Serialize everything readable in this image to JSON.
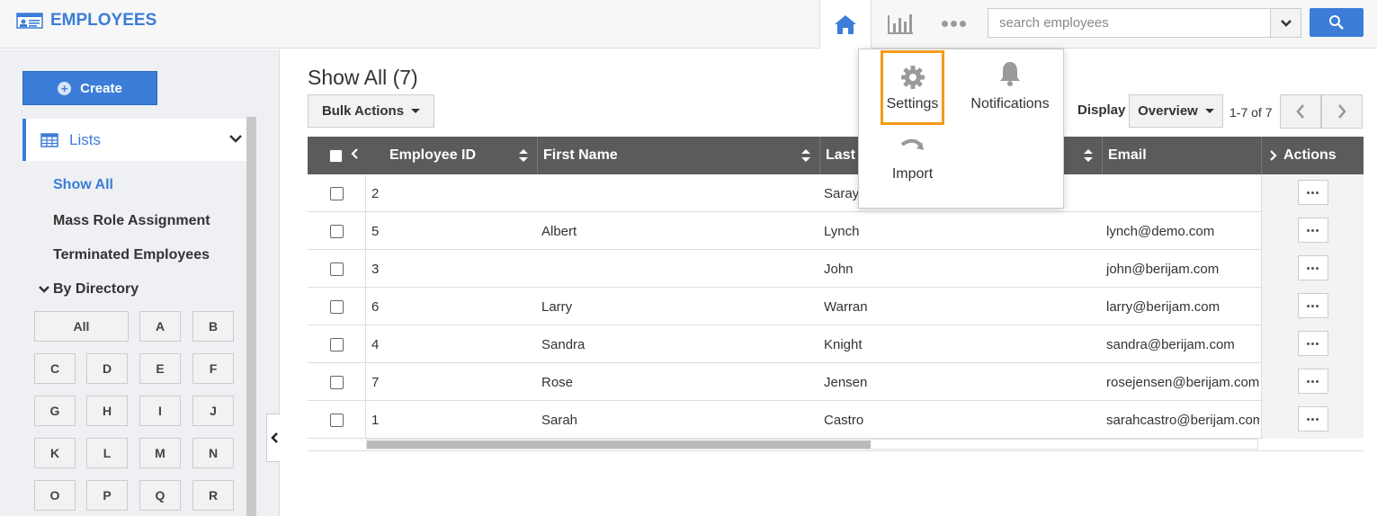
{
  "app": {
    "title": "EMPLOYEES"
  },
  "header": {
    "search": {
      "placeholder": "search employees",
      "value": ""
    }
  },
  "sidebar": {
    "create_label": "Create",
    "lists_label": "Lists",
    "links": [
      "Show All",
      "Mass Role Assignment",
      "Terminated Employees"
    ],
    "directory_label": "By Directory",
    "letters": [
      "All",
      "A",
      "B",
      "C",
      "D",
      "E",
      "F",
      "G",
      "H",
      "I",
      "J",
      "K",
      "L",
      "M",
      "N",
      "O",
      "P",
      "Q",
      "R"
    ]
  },
  "main": {
    "title": "Show All (7)",
    "bulk_actions": "Bulk Actions",
    "display_label": "Display",
    "display_value": "Overview",
    "pager": "1-7 of 7"
  },
  "table": {
    "columns": [
      "Employee ID",
      "First Name",
      "Last",
      "Email",
      "Actions"
    ],
    "rows": [
      {
        "id": "2",
        "first": "",
        "last": "Saray",
        "email": ""
      },
      {
        "id": "5",
        "first": "Albert",
        "last": "Lynch",
        "email": "lynch@demo.com"
      },
      {
        "id": "3",
        "first": "",
        "last": "John",
        "email": "john@berijam.com"
      },
      {
        "id": "6",
        "first": "Larry",
        "last": "Warran",
        "email": "larry@berijam.com"
      },
      {
        "id": "4",
        "first": "Sandra",
        "last": "Knight",
        "email": "sandra@berijam.com"
      },
      {
        "id": "7",
        "first": "Rose",
        "last": "Jensen",
        "email": "rosejensen@berijam.com"
      },
      {
        "id": "1",
        "first": "Sarah",
        "last": "Castro",
        "email": "sarahcastro@berijam.com"
      }
    ]
  },
  "popover": {
    "settings": "Settings",
    "notifications": "Notifications",
    "import": "Import"
  },
  "colors": {
    "accent": "#3b7dd8",
    "highlight": "#f59a1b",
    "table_header": "#5b5b5b"
  },
  "icons": [
    "employees-icon",
    "home-icon",
    "bar-chart-icon",
    "more-icon",
    "search-icon",
    "settings-icon",
    "bell-icon",
    "import-icon",
    "table-icon"
  ]
}
